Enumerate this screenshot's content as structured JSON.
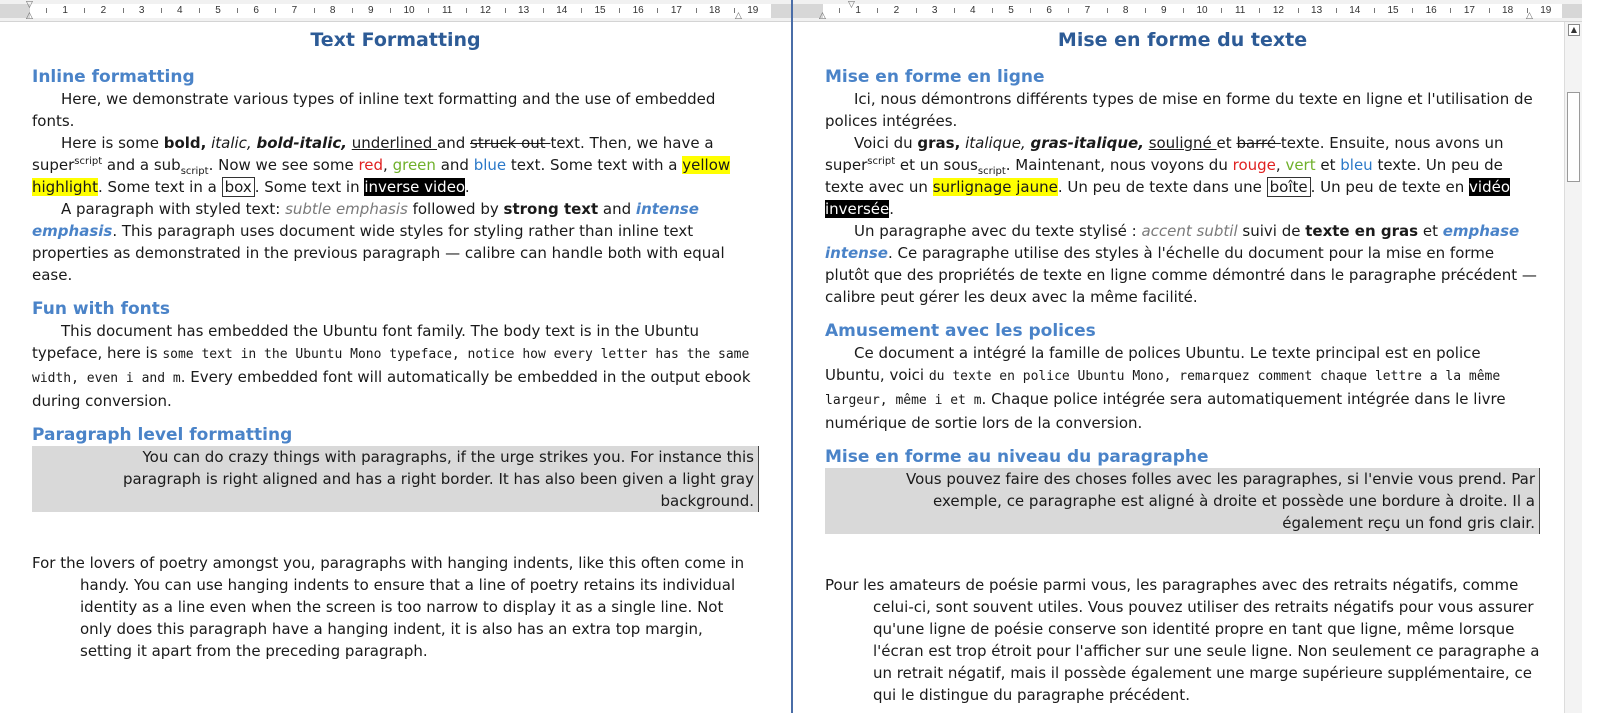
{
  "ruler": {
    "ticks": [
      "1",
      "2",
      "3",
      "4",
      "5",
      "6",
      "7",
      "8",
      "9",
      "10",
      "11",
      "12",
      "13",
      "14",
      "15",
      "16",
      "17",
      "18",
      "19"
    ]
  },
  "left": {
    "title": "Text Formatting",
    "h_inline": "Inline formatting",
    "p1": "Here, we demonstrate various types of inline text formatting and the use of embedded fonts.",
    "p2": {
      "t1": "Here is some ",
      "bold": "bold,",
      "t2": " ",
      "italic": "italic,",
      "t3": " ",
      "bolditalic": "bold-italic,",
      "t4": " ",
      "underlined": "underlined ",
      "t5": "and ",
      "struck": "struck out ",
      "t6": " text. Then, we have a super",
      "sup": "script",
      "t7": " and a sub",
      "sub": "script",
      "t8": ". Now we see some ",
      "red": "red",
      "t9": ", ",
      "green": "green",
      "t10": " and ",
      "blue": "blue",
      "t11": " text. Some text with a ",
      "yellow": "yellow highlight",
      "t12": ". Some text in a ",
      "box": "box",
      "t13": ". Some text in ",
      "inverse": "inverse video",
      "t14": "."
    },
    "p3": {
      "t1": "A paragraph with styled text: ",
      "subtle": "subtle emphasis",
      "t2": "  followed by ",
      "strong": "strong text",
      "t3": " and ",
      "intense": "intense emphasis",
      "t4": ". This paragraph uses document wide styles for styling rather than inline text properties as demonstrated in the previous paragraph — calibre can handle both with equal ease."
    },
    "h_fonts": "Fun with fonts",
    "p4": {
      "t1": "This document has embedded the Ubuntu font family. The body text is in the Ubuntu typeface, here is ",
      "mono": "some text in the Ubuntu Mono typeface, notice how every letter has the same width, even i and m",
      "t2": ". Every embedded font will automatically be embedded in the output ebook during conversion."
    },
    "h_para": "Paragraph level formatting",
    "p5": "You can do crazy things with paragraphs, if the urge strikes you. For instance this paragraph is right aligned and has a right border. It has also been given a light gray background.",
    "p6": "For the lovers of poetry amongst you, paragraphs with hanging indents, like this often come in handy. You can use hanging indents to ensure that a line of poetry retains its individual identity as a line even when the screen is  too narrow to display it as a single line. Not only does this paragraph have a hanging indent, it is also has an extra top margin, setting it apart from the preceding paragraph."
  },
  "right": {
    "title": "Mise en forme du texte",
    "h_inline": "Mise en forme en ligne",
    "p1": "Ici, nous démontrons différents types de mise en forme du texte en ligne et l'utilisation de polices intégrées.",
    "p2": {
      "t1": "Voici du ",
      "bold": "gras,",
      "t2": " ",
      "italic": "italique,",
      "t3": " ",
      "bolditalic": "gras-italique,",
      "t4": " ",
      "underlined": "souligné ",
      "t5": "et ",
      "struck": "barré ",
      "t6": " texte. Ensuite, nous avons un super",
      "sup": "script",
      "t7": " et un sous",
      "sub": "script",
      "t8": ". Maintenant, nous voyons du ",
      "red": "rouge",
      "t9": ", ",
      "green": "vert",
      "t10": " et ",
      "blue": "bleu",
      "t11": " texte. Un peu de texte avec un ",
      "yellow": "surlignage jaune",
      "t12": ". Un peu de texte dans une ",
      "box": "boîte",
      "t13": ". Un peu de texte en ",
      "inverse": "vidéo inversée",
      "t14": "."
    },
    "p3": {
      "t1": "Un paragraphe avec du texte stylisé : ",
      "subtle": "accent subtil",
      "t2": "  suivi de ",
      "strong": "texte en gras",
      "t3": " et ",
      "intense": "emphase intense",
      "t4": ". Ce paragraphe utilise des styles à l'échelle du document pour la mise en forme plutôt que des propriétés de texte en ligne comme démontré dans le paragraphe précédent — calibre peut gérer les deux avec la même facilité."
    },
    "h_fonts": "Amusement avec les polices",
    "p4": {
      "t1": "Ce document a intégré la famille de polices Ubuntu. Le texte principal est en police Ubuntu, voici ",
      "mono": "du texte en police Ubuntu Mono, remarquez comment chaque lettre a la même largeur, même i et m",
      "t2": ". Chaque police intégrée sera automatiquement intégrée dans le livre numérique de sortie lors de la conversion."
    },
    "h_para": "Mise en forme au niveau du paragraphe",
    "p5": "Vous pouvez faire des choses folles avec les paragraphes, si l'envie vous prend. Par exemple, ce paragraphe est aligné à droite et possède une bordure à droite. Il a également reçu un fond gris clair.",
    "p6": "Pour les amateurs de poésie parmi vous, les paragraphes avec des retraits négatifs, comme celui-ci, sont souvent utiles. Vous pouvez utiliser des retraits négatifs pour vous assurer qu'une ligne de poésie conserve son identité propre en tant que ligne, même lorsque l'écran est trop étroit pour l'afficher sur une seule ligne. Non seulement ce paragraphe a un retrait négatif, mais il possède également une marge supérieure supplémentaire, ce qui le distingue du paragraphe précédent."
  },
  "icons": {
    "scroll_up": "chevron-up-icon",
    "indent_marker": "hourglass-marker-icon"
  }
}
